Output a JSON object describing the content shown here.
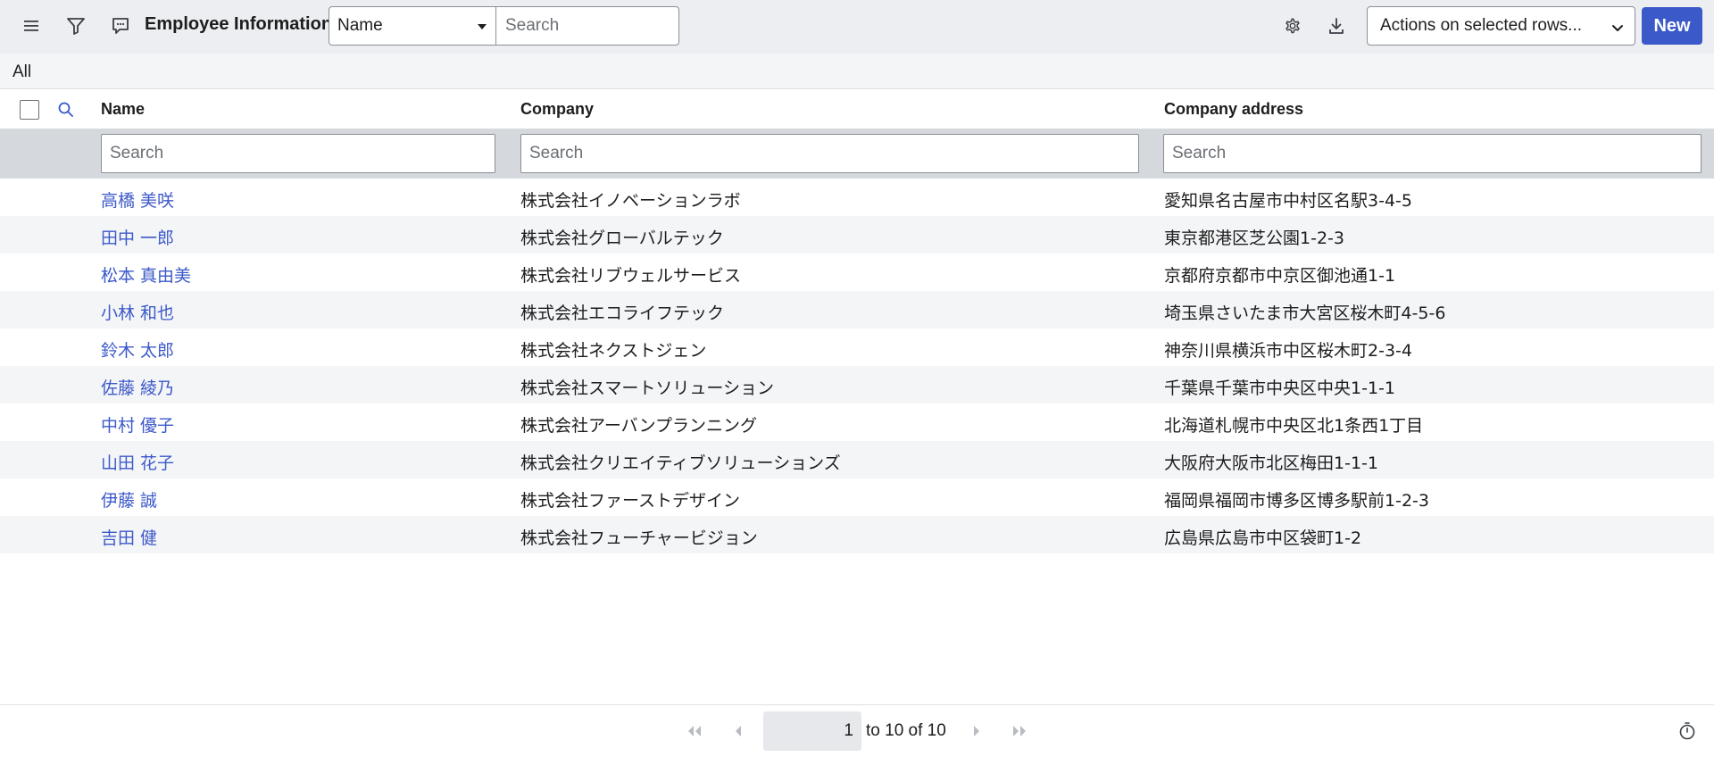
{
  "header": {
    "title": "Employee Informations",
    "field_select_value": "Name",
    "search_placeholder": "Search",
    "actions_select_value": "Actions on selected rows...",
    "new_label": "New",
    "icons": [
      "hamburger-menu-icon",
      "filter-icon",
      "comment-icon",
      "gear-icon",
      "download-icon"
    ]
  },
  "breadcrumb": {
    "label": "All"
  },
  "table": {
    "columns": [
      {
        "label": "Name",
        "filter_placeholder": "Search"
      },
      {
        "label": "Company",
        "filter_placeholder": "Search"
      },
      {
        "label": "Company address",
        "filter_placeholder": "Search"
      }
    ],
    "rows": [
      {
        "name": "高橋 美咲",
        "company": "株式会社イノベーションラボ",
        "address": "愛知県名古屋市中村区名駅3-4-5"
      },
      {
        "name": "田中 一郎",
        "company": "株式会社グローバルテック",
        "address": "東京都港区芝公園1-2-3"
      },
      {
        "name": "松本 真由美",
        "company": "株式会社リブウェルサービス",
        "address": "京都府京都市中京区御池通1-1"
      },
      {
        "name": "小林 和也",
        "company": "株式会社エコライフテック",
        "address": "埼玉県さいたま市大宮区桜木町4-5-6"
      },
      {
        "name": "鈴木 太郎",
        "company": "株式会社ネクストジェン",
        "address": "神奈川県横浜市中区桜木町2-3-4"
      },
      {
        "name": "佐藤 綾乃",
        "company": "株式会社スマートソリューション",
        "address": "千葉県千葉市中央区中央1-1-1"
      },
      {
        "name": "中村 優子",
        "company": "株式会社アーバンプランニング",
        "address": "北海道札幌市中央区北1条西1丁目"
      },
      {
        "name": "山田 花子",
        "company": "株式会社クリエイティブソリューションズ",
        "address": "大阪府大阪市北区梅田1-1-1"
      },
      {
        "name": "伊藤 誠",
        "company": "株式会社ファーストデザイン",
        "address": "福岡県福岡市博多区博多駅前1-2-3"
      },
      {
        "name": "吉田 健",
        "company": "株式会社フューチャービジョン",
        "address": "広島県広島市中区袋町1-2"
      }
    ]
  },
  "pagination": {
    "current_page": "1",
    "range_text": "to 10 of 10"
  },
  "colors": {
    "accent": "#3c59c9",
    "header_bg": "#eceef1",
    "filter_row_bg": "#d5d8dc",
    "alt_row_bg": "#f4f5f7"
  }
}
